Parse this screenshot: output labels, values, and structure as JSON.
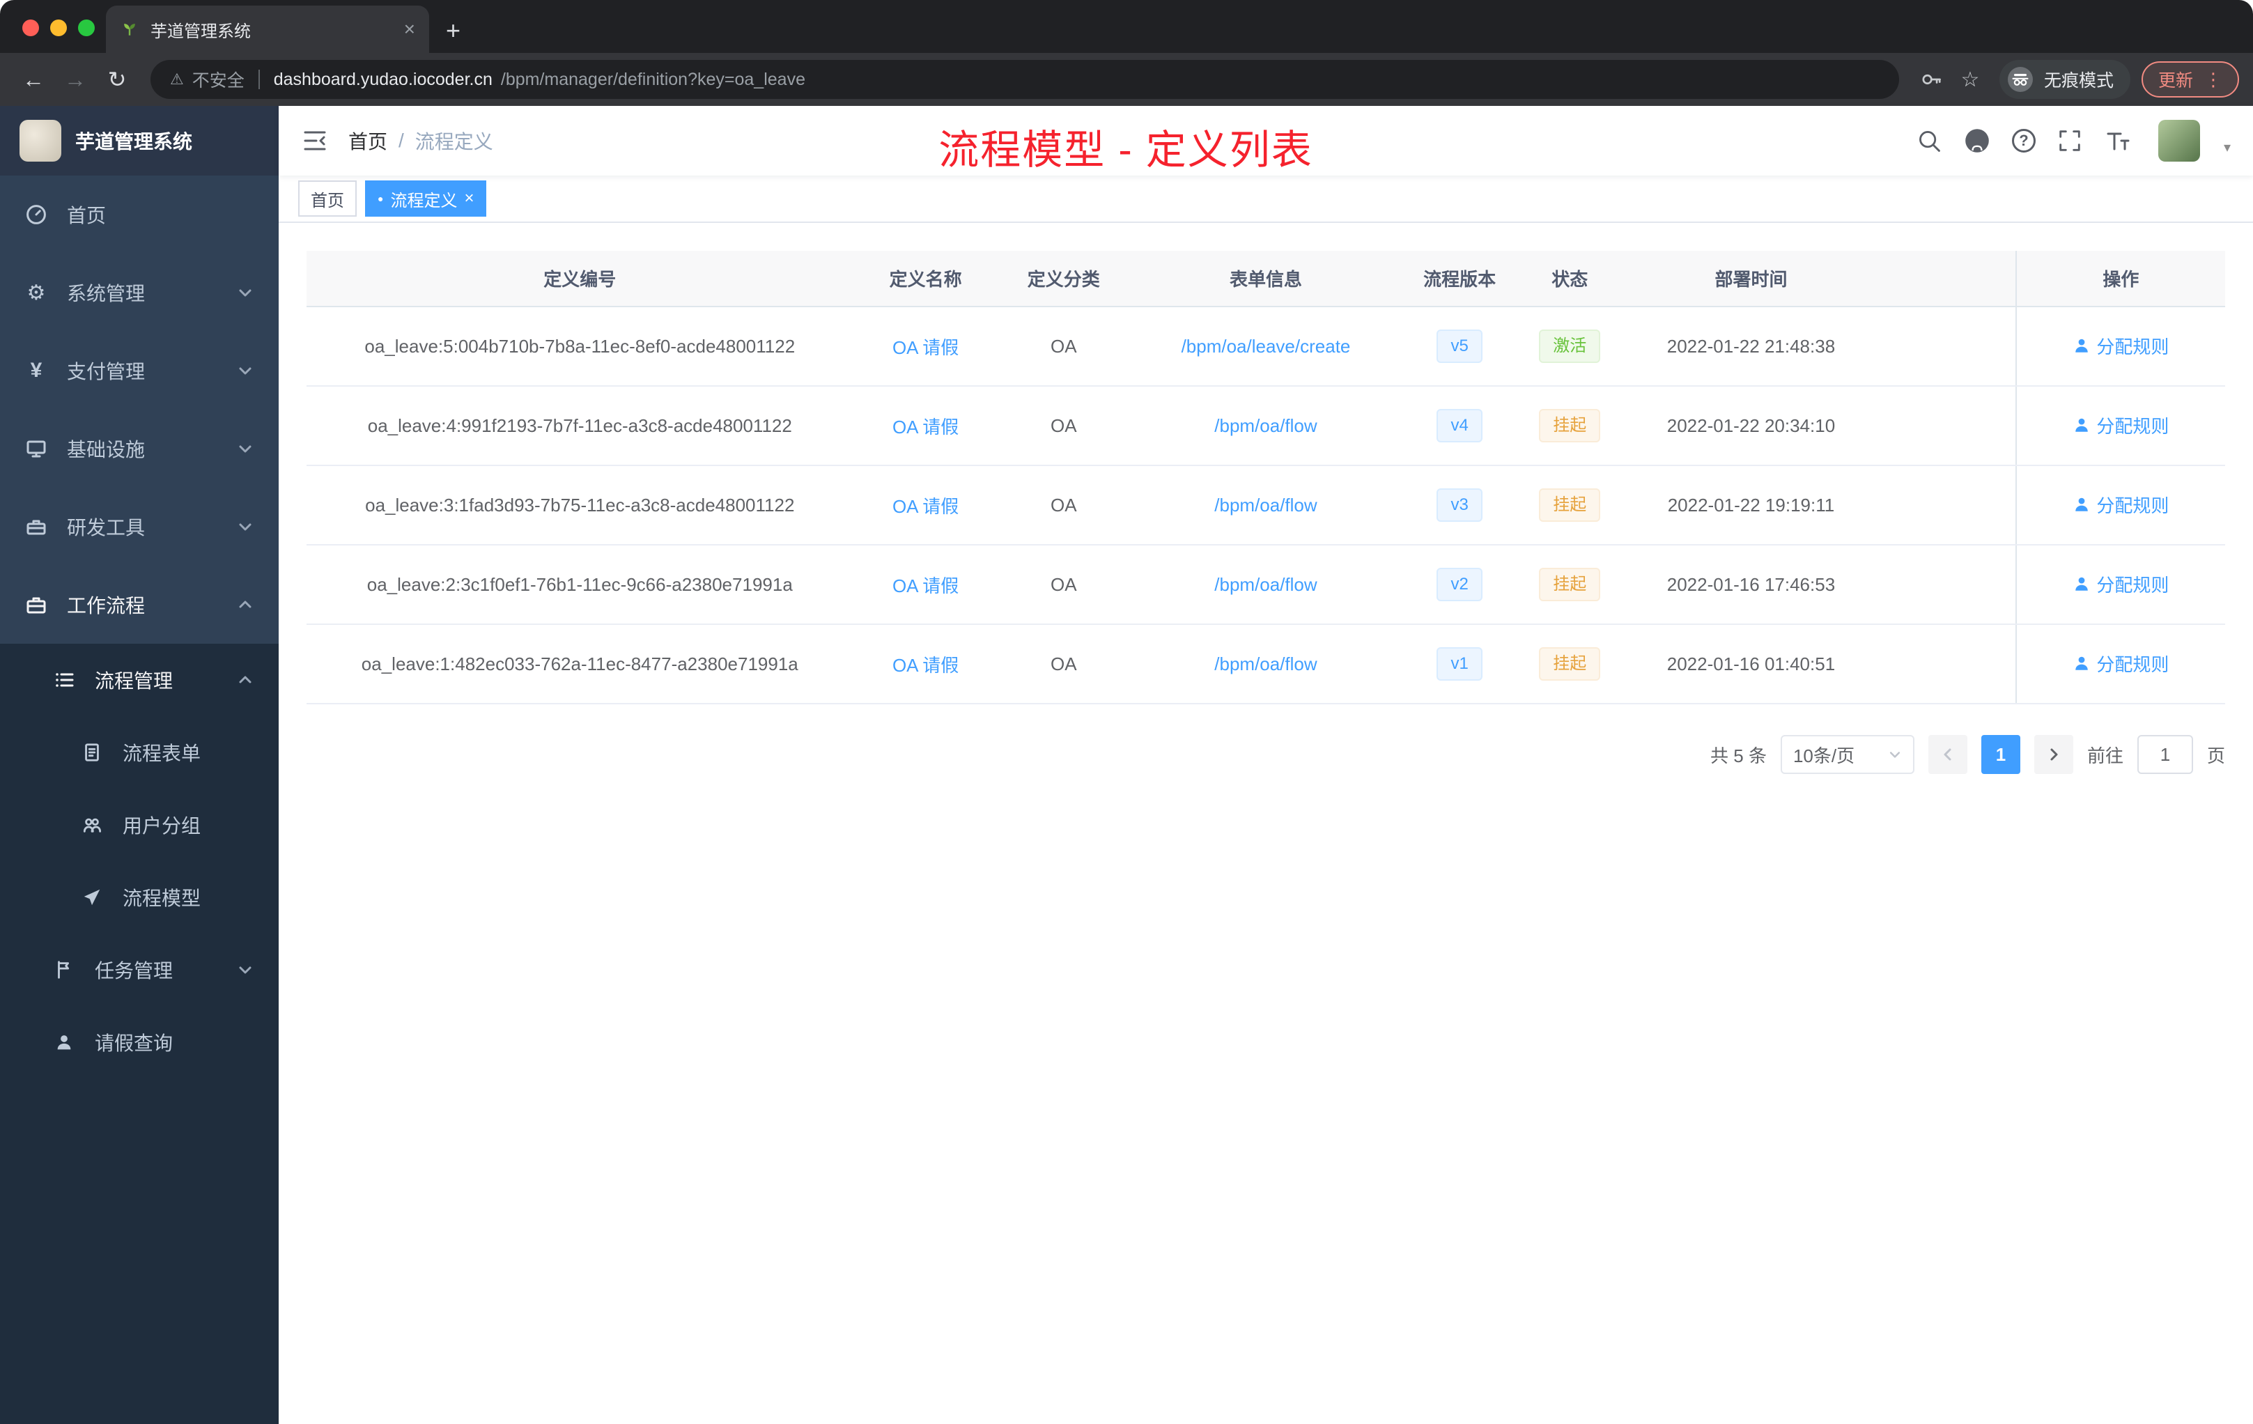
{
  "browser": {
    "tab_title": "芋道管理系统",
    "url_security": "不安全",
    "url_host": "dashboard.yudao.iocoder.cn",
    "url_path": "/bpm/manager/definition?key=oa_leave",
    "incognito_label": "无痕模式",
    "update_label": "更新"
  },
  "icons": {
    "close": "×",
    "plus": "+",
    "overflow": "⋮",
    "back": "←",
    "forward": "→",
    "reload": "↻",
    "warning": "⚠",
    "star": "☆",
    "help": "?",
    "gear": "⚙",
    "yen": "¥",
    "slash": "/",
    "dot": "●",
    "caret": "▾"
  },
  "colors": {
    "accent_blue": "#409eff",
    "success_green": "#67c23a",
    "warning_orange": "#e6a23c",
    "annotation_red": "#f5222d",
    "sidebar_bg": "#304156",
    "submenu_bg": "#1f2d3d"
  },
  "sidebar": {
    "logo_title": "芋道管理系统",
    "items": [
      {
        "label": "首页",
        "icon": "dashboard-icon"
      },
      {
        "label": "系统管理",
        "icon": "gear-icon",
        "expandable": true
      },
      {
        "label": "支付管理",
        "icon": "yen-icon",
        "expandable": true
      },
      {
        "label": "基础设施",
        "icon": "monitor-icon",
        "expandable": true
      },
      {
        "label": "研发工具",
        "icon": "toolbox-icon",
        "expandable": true
      },
      {
        "label": "工作流程",
        "icon": "briefcase-icon",
        "expandable": true,
        "expanded": true
      }
    ],
    "sub_items": [
      {
        "label": "流程管理",
        "icon": "list-icon",
        "expandable": true,
        "expanded": true
      },
      {
        "label": "流程表单",
        "icon": "form-icon"
      },
      {
        "label": "用户分组",
        "icon": "group-icon"
      },
      {
        "label": "流程模型",
        "icon": "send-icon"
      },
      {
        "label": "任务管理",
        "icon": "task-icon",
        "expandable": true
      },
      {
        "label": "请假查询",
        "icon": "user-icon"
      }
    ]
  },
  "header": {
    "breadcrumb_home": "首页",
    "breadcrumb_current": "流程定义",
    "annotation": "流程模型 - 定义列表"
  },
  "tags": {
    "home": "首页",
    "active": "流程定义"
  },
  "table": {
    "columns": [
      "定义编号",
      "定义名称",
      "定义分类",
      "表单信息",
      "流程版本",
      "状态",
      "部署时间",
      "操作"
    ],
    "rows": [
      {
        "id": "oa_leave:5:004b710b-7b8a-11ec-8ef0-acde48001122",
        "name": "OA 请假",
        "category": "OA",
        "form": "/bpm/oa/leave/create",
        "version": "v5",
        "status": "激活",
        "status_type": "success",
        "time": "2022-01-22 21:48:38",
        "action": "分配规则"
      },
      {
        "id": "oa_leave:4:991f2193-7b7f-11ec-a3c8-acde48001122",
        "name": "OA 请假",
        "category": "OA",
        "form": "/bpm/oa/flow",
        "version": "v4",
        "status": "挂起",
        "status_type": "warning",
        "time": "2022-01-22 20:34:10",
        "action": "分配规则"
      },
      {
        "id": "oa_leave:3:1fad3d93-7b75-11ec-a3c8-acde48001122",
        "name": "OA 请假",
        "category": "OA",
        "form": "/bpm/oa/flow",
        "version": "v3",
        "status": "挂起",
        "status_type": "warning",
        "time": "2022-01-22 19:19:11",
        "action": "分配规则"
      },
      {
        "id": "oa_leave:2:3c1f0ef1-76b1-11ec-9c66-a2380e71991a",
        "name": "OA 请假",
        "category": "OA",
        "form": "/bpm/oa/flow",
        "version": "v2",
        "status": "挂起",
        "status_type": "warning",
        "time": "2022-01-16 17:46:53",
        "action": "分配规则"
      },
      {
        "id": "oa_leave:1:482ec033-762a-11ec-8477-a2380e71991a",
        "name": "OA 请假",
        "category": "OA",
        "form": "/bpm/oa/flow",
        "version": "v1",
        "status": "挂起",
        "status_type": "warning",
        "time": "2022-01-16 01:40:51",
        "action": "分配规则"
      }
    ]
  },
  "pagination": {
    "total": "共 5 条",
    "page_size": "10条/页",
    "page": "1",
    "goto": "前往",
    "goto_value": "1",
    "unit": "页"
  }
}
